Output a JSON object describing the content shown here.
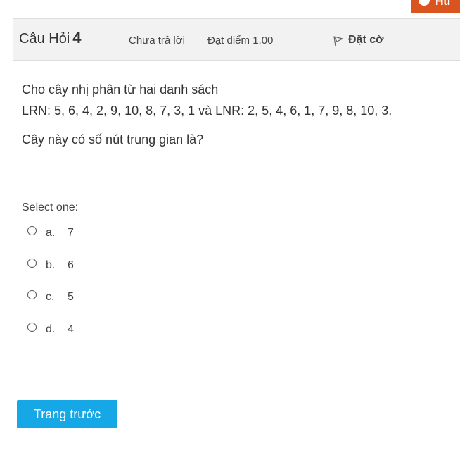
{
  "corner_button": {
    "label": "Hủ",
    "color": "#d9541e"
  },
  "info": {
    "title_prefix": "Câu Hỏi",
    "question_number": "4",
    "state": "Chưa trả lời",
    "grade": "Đạt điểm 1,00",
    "flag_label": "Đặt cờ",
    "flag_icon": "flag-outline-icon"
  },
  "question": {
    "line1": "Cho cây nhị phân từ hai danh sách",
    "line2": "LRN: 5, 6, 4, 2, 9, 10, 8, 7, 3, 1 và LNR: 2, 5, 4, 6, 1, 7, 9, 8, 10, 3.",
    "line3": "Cây này có số nút trung gian là?"
  },
  "prompt": "Select one:",
  "answers": [
    {
      "letter": "a.",
      "value": "7"
    },
    {
      "letter": "b.",
      "value": "6"
    },
    {
      "letter": "c.",
      "value": "5"
    },
    {
      "letter": "d.",
      "value": "4"
    }
  ],
  "nav": {
    "prev_label": "Trang trước",
    "prev_color": "#16a8e6"
  }
}
